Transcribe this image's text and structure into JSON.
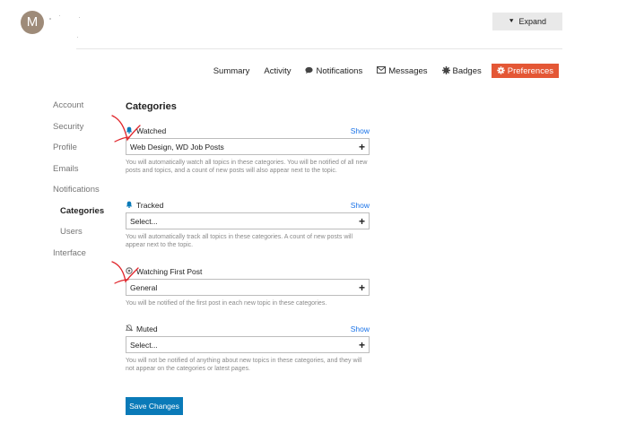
{
  "user": {
    "avatar_letter": "M"
  },
  "header": {
    "expand_label": "Expand",
    "expand_icon": "collapse-expand-chevrons-icon"
  },
  "tabs": [
    {
      "label": "Summary"
    },
    {
      "label": "Activity"
    },
    {
      "label": "Notifications",
      "icon": "speech-bubble-icon"
    },
    {
      "label": "Messages",
      "icon": "envelope-icon"
    },
    {
      "label": "Badges",
      "icon": "badge-gear-icon"
    },
    {
      "label": "Preferences",
      "icon": "gear-icon",
      "active": true
    }
  ],
  "sidenav": [
    {
      "label": "Account"
    },
    {
      "label": "Security"
    },
    {
      "label": "Profile"
    },
    {
      "label": "Emails"
    },
    {
      "label": "Notifications"
    },
    {
      "label": "Categories",
      "active": true
    },
    {
      "label": "Users"
    },
    {
      "label": "Interface"
    }
  ],
  "content": {
    "title": "Categories",
    "show_label": "Show",
    "watched": {
      "label": "Watched",
      "value": "Web Design, WD Job Posts",
      "help": "You will automatically watch all topics in these categories. You will be notified of all new posts and topics, and a count of new posts will also appear next to the topic."
    },
    "tracked": {
      "label": "Tracked",
      "value": "Select...",
      "help": "You will automatically track all topics in these categories. A count of new posts will appear next to the topic."
    },
    "watching_first": {
      "label": "Watching First Post",
      "value": "General",
      "help": "You will be notified of the first post in each new topic in these categories."
    },
    "muted": {
      "label": "Muted",
      "value": "Select...",
      "help": "You will not be notified of anything about new topics in these categories, and they will not appear on the categories or latest pages."
    },
    "save_label": "Save Changes"
  },
  "colors": {
    "accent": "#e45735",
    "primary": "#0a7ab8",
    "annotation": "#e0242a"
  }
}
